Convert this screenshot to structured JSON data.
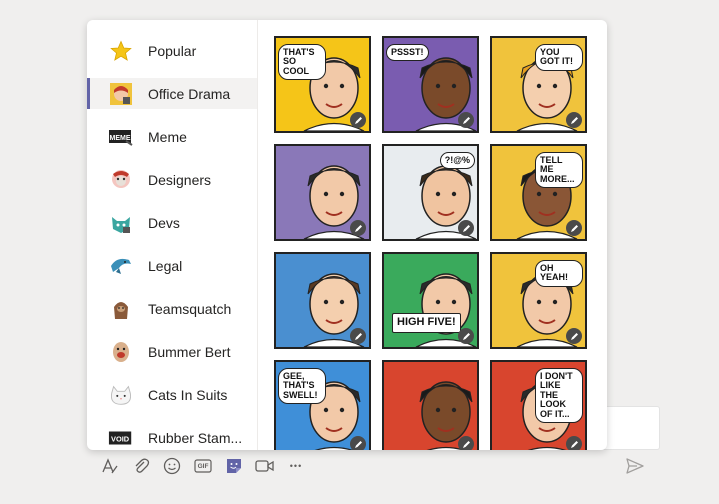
{
  "categories": [
    {
      "label": "Popular",
      "icon": "star-icon"
    },
    {
      "label": "Office Drama",
      "icon": "office-drama-icon",
      "active": true
    },
    {
      "label": "Meme",
      "icon": "meme-icon"
    },
    {
      "label": "Designers",
      "icon": "designers-icon"
    },
    {
      "label": "Devs",
      "icon": "devs-icon"
    },
    {
      "label": "Legal",
      "icon": "legal-icon"
    },
    {
      "label": "Teamsquatch",
      "icon": "teamsquatch-icon"
    },
    {
      "label": "Bummer Bert",
      "icon": "bummer-bert-icon"
    },
    {
      "label": "Cats In Suits",
      "icon": "cats-in-suits-icon"
    },
    {
      "label": "Rubber Stam...",
      "icon": "rubber-stamp-icon"
    }
  ],
  "stickers": [
    {
      "caption": "THAT'S SO COOL",
      "bg": "#f5c518"
    },
    {
      "caption": "PSSST!",
      "bg": "#7a5cb0"
    },
    {
      "caption": "YOU GOT IT!",
      "bg": "#f0c33c"
    },
    {
      "caption": "",
      "bg": "#8a78b8"
    },
    {
      "caption": "?!@%",
      "bg": "#e8ecef"
    },
    {
      "caption": "TELL ME MORE...",
      "bg": "#f0c33c"
    },
    {
      "caption": "",
      "bg": "#4a8fd0"
    },
    {
      "caption": "HIGH FIVE!",
      "bg": "#3aaa5c"
    },
    {
      "caption": "OH YEAH!",
      "bg": "#f0c33c"
    },
    {
      "caption": "GEE, THAT'S SWELL!",
      "bg": "#3f8fd8"
    },
    {
      "caption": "",
      "bg": "#d8452e"
    },
    {
      "caption": "I DON'T LIKE THE LOOK OF IT...",
      "bg": "#d8452e"
    }
  ],
  "toolbar": [
    {
      "name": "format-icon"
    },
    {
      "name": "attach-icon"
    },
    {
      "name": "emoji-icon"
    },
    {
      "name": "gif-icon",
      "text": "GIF"
    },
    {
      "name": "sticker-icon",
      "active": true
    },
    {
      "name": "meet-now-icon"
    },
    {
      "name": "more-options-icon",
      "text": "•••"
    }
  ],
  "colors": {
    "accent": "#6264a7",
    "panel": "#ffffff",
    "background": "#f0efee"
  }
}
